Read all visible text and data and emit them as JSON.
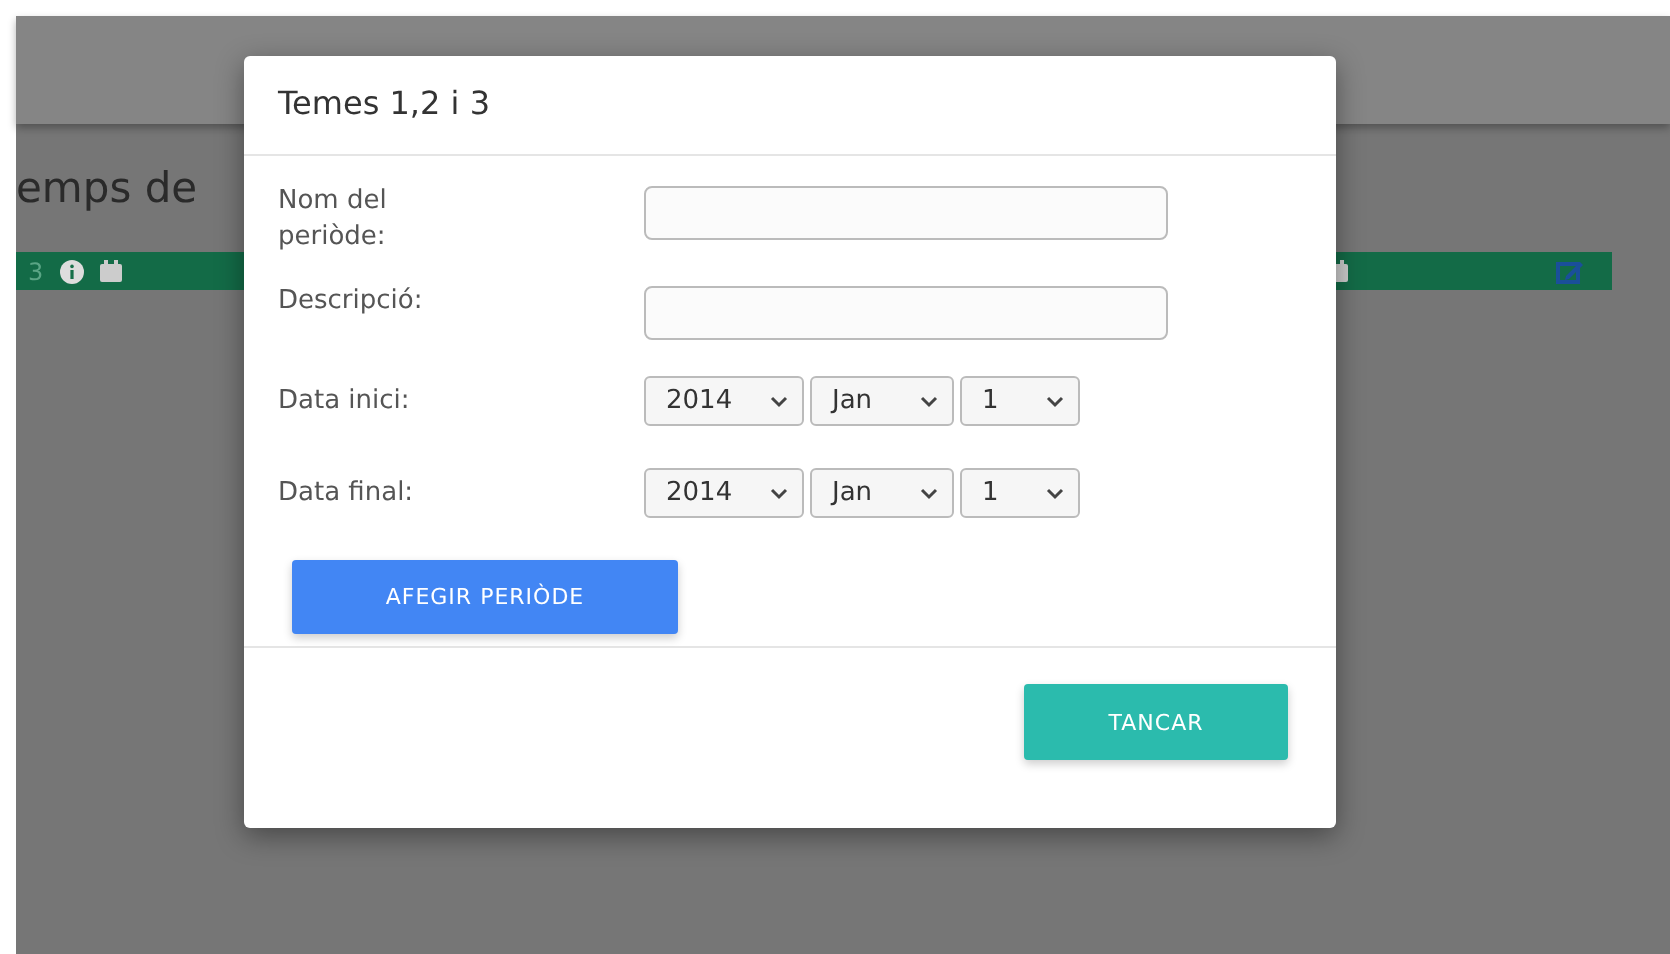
{
  "page": {
    "heading": "emps de",
    "bar": {
      "count": "3"
    }
  },
  "modal": {
    "title": "Temes 1,2 i 3",
    "fields": [
      {
        "kind": "text",
        "label": "Nom del periòde:"
      },
      {
        "kind": "text",
        "label": "Descripció:"
      },
      {
        "kind": "date",
        "label": "Data inici:",
        "selects": [
          "2014",
          "Jan",
          "1"
        ]
      },
      {
        "kind": "date",
        "label": "Data final:",
        "selects": [
          "2014",
          "Jan",
          "1"
        ]
      }
    ],
    "add_button": "AFEGIR PERIÒDE",
    "close_button": "TANCAR"
  }
}
